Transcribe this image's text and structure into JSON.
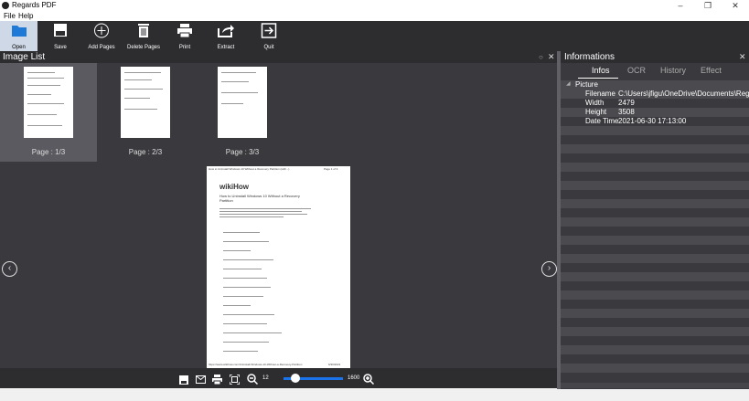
{
  "window": {
    "title": "Regards PDF",
    "min": "–",
    "restore": "❐",
    "close": "✕"
  },
  "menu": [
    "File",
    "Help"
  ],
  "toolbar": [
    {
      "label": "Open",
      "icon": "folder-icon"
    },
    {
      "label": "Save",
      "icon": "save-icon"
    },
    {
      "label": "Add Pages",
      "icon": "add-circle-icon"
    },
    {
      "label": "Delete Pages",
      "icon": "trash-icon"
    },
    {
      "label": "Print",
      "icon": "print-icon"
    },
    {
      "label": "Extract",
      "icon": "share-icon"
    },
    {
      "label": "Quit",
      "icon": "exit-icon"
    }
  ],
  "image_list": {
    "title": "Image List",
    "thumbnails": [
      "Page : 1/3",
      "Page : 2/3",
      "Page : 3/3"
    ],
    "selected": 0
  },
  "viewer": {
    "zoom_min": "12",
    "zoom_max": "1600",
    "zoom_level": 0.2,
    "page": {
      "header_left": "How to Uninstall Windows 10 Without a Recovery Partition (with...)",
      "header_right": "Page 1 of 3",
      "brand": "wikiHow",
      "heading": "How to Uninstall Windows 10 Without a Recovery Partition",
      "footer_left": "https://www.wikihow.com/Uninstall-Windows-10-Without-a-Recovery-Partition",
      "footer_right": "6/30/2021"
    }
  },
  "info": {
    "title": "Informations",
    "tabs": [
      "Infos",
      "OCR",
      "History",
      "Effect"
    ],
    "active_tab": 0,
    "section": "Picture",
    "rows": [
      {
        "key": "Filename",
        "value": "C:\\Users\\jfigu\\OneDrive\\Documents\\Regards\\t"
      },
      {
        "key": "Width",
        "value": "2479"
      },
      {
        "key": "Height",
        "value": "3508"
      },
      {
        "key": "Date Time",
        "value": "2021-06-30 17:13:00"
      }
    ]
  },
  "colors": {
    "toolbar_bg": "#2d2d30",
    "panel_bg": "#3a3a3e",
    "accent": "#1a73e8"
  }
}
